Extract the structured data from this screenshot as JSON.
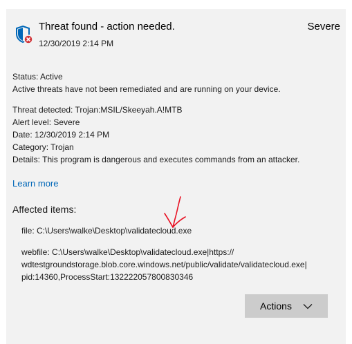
{
  "header": {
    "icon": "shield-error-icon",
    "title": "Threat found - action needed.",
    "severity": "Severe",
    "timestamp": "12/30/2019 2:14 PM"
  },
  "status": {
    "line": "Status:  Active",
    "description": "Active threats have not been remediated and are running on your device."
  },
  "threat": {
    "detected": "Threat detected:  Trojan:MSIL/Skeeyah.A!MTB",
    "alert_level": "Alert level:  Severe",
    "date": "Date:  12/30/2019 2:14 PM",
    "category": "Category:  Trojan",
    "details": "Details:  This program is dangerous and executes commands from an attacker."
  },
  "learn_more": "Learn more",
  "affected": {
    "title": "Affected items:",
    "file": "file: C:\\Users\\walke\\Desktop\\validatecloud.exe",
    "webfile_lines": [
      "webfile: C:\\Users\\walke\\Desktop\\validatecloud.exe|https://",
      "wdtestgroundstorage.blob.core.windows.net/public/validate/validatecloud.exe|",
      "pid:14360,ProcessStart:132222057800830346"
    ]
  },
  "actions": {
    "label": "Actions",
    "icon": "chevron-down-icon"
  },
  "colors": {
    "link": "#0067b8",
    "shield": "#0067b8",
    "error_badge": "#d13438",
    "annotation": "#e81123",
    "card_bg": "#f2f2f2",
    "button_bg": "#cccccc"
  }
}
